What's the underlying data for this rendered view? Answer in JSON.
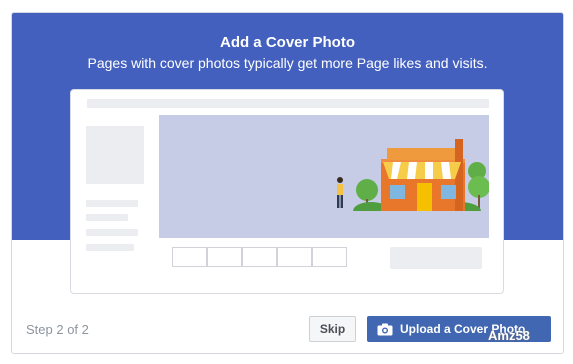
{
  "dialog": {
    "title": "Add a Cover Photo",
    "subtitle": "Pages with cover photos typically get more Page likes and visits.",
    "step": "Step 2 of 2",
    "skip_label": "Skip",
    "upload_label": "Upload a Cover Photo"
  },
  "icons": {
    "upload": "camera-icon"
  },
  "colors": {
    "hero": "#4360be",
    "upload_button": "#4267b2",
    "store_orange": "#e8762b",
    "awning_yellow": "#f6cd4a",
    "tree_green": "#5fae48"
  },
  "watermark": "Amz58"
}
